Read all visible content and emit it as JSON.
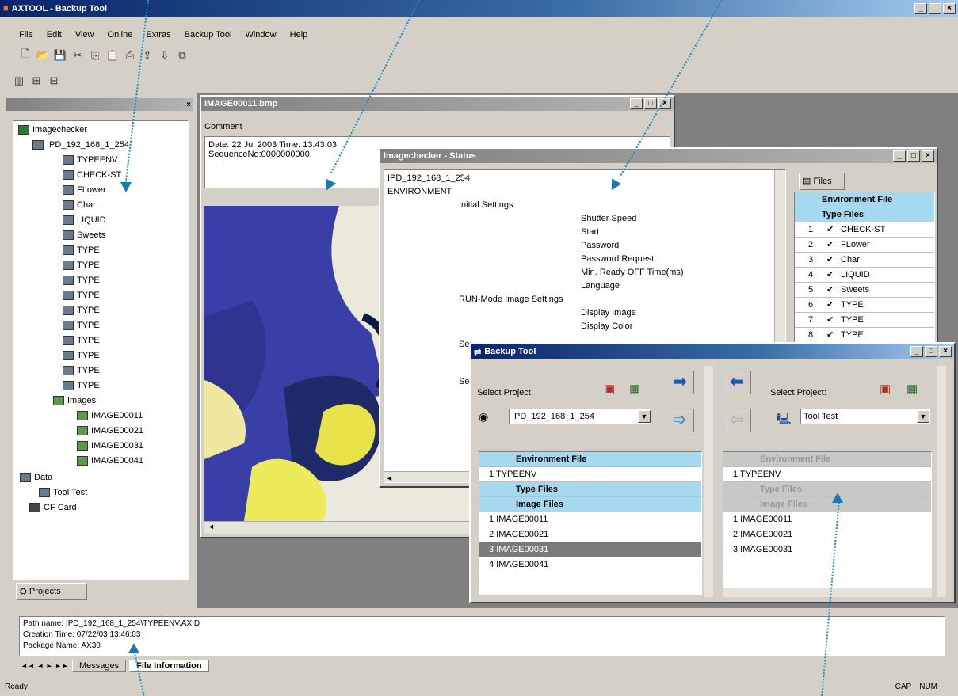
{
  "app": {
    "title": "AXTOOL - Backup Tool"
  },
  "menu": [
    "File",
    "Edit",
    "View",
    "Online",
    "Extras",
    "Backup Tool",
    "Window",
    "Help"
  ],
  "tree": {
    "root": "Imagechecker",
    "device": "IPD_192_168_1_254",
    "items": [
      "TYPEENV",
      "CHECK-ST",
      "FLower",
      "Char",
      "LIQUID",
      "Sweets",
      "TYPE",
      "TYPE",
      "TYPE",
      "TYPE",
      "TYPE",
      "TYPE",
      "TYPE",
      "TYPE",
      "TYPE",
      "TYPE"
    ],
    "images_folder": "Images",
    "images": [
      "IMAGE00011",
      "IMAGE00021",
      "IMAGE00031",
      "IMAGE00041"
    ],
    "data_folder": "Data",
    "tool_test": "Tool Test",
    "cf_card": "CF Card",
    "tab": "Projects"
  },
  "image_window": {
    "title": "IMAGE00011.bmp",
    "comment_label": "Comment",
    "date_line": "Date: 22 Jul 2003 Time: 13:43:03",
    "seq_line": "SequenceNo:0000000000"
  },
  "status_window": {
    "title": "Imagechecker - Status",
    "device": "IPD_192_168_1_254",
    "environment": "ENVIRONMENT",
    "initial_settings": "Initial Settings",
    "settings": [
      "Shutter Speed",
      "Start",
      "Password",
      "Password Request",
      "Min. Ready OFF Time(ms)",
      "Language"
    ],
    "run_mode": "RUN-Mode Image Settings",
    "run_settings": [
      "Display Image",
      "Display Color"
    ],
    "se1": "Se",
    "se2": "Se",
    "files_tab": "Files",
    "env_file": "Environment File",
    "type_files": "Type Files",
    "files": [
      {
        "n": "1",
        "name": "CHECK-ST"
      },
      {
        "n": "2",
        "name": "FLower"
      },
      {
        "n": "3",
        "name": "Char"
      },
      {
        "n": "4",
        "name": "LIQUID"
      },
      {
        "n": "5",
        "name": "Sweets"
      },
      {
        "n": "6",
        "name": "TYPE"
      },
      {
        "n": "7",
        "name": "TYPE"
      },
      {
        "n": "8",
        "name": "TYPE"
      }
    ]
  },
  "backup_window": {
    "title": "Backup Tool",
    "left": {
      "select_label": "Select Project:",
      "project": "IPD_192_168_1_254",
      "env_file": "Environment File",
      "env_item": "1 TYPEENV",
      "type_files": "Type Files",
      "image_files": "Image Files",
      "images": [
        "1 IMAGE00011",
        "2 IMAGE00021",
        "3 IMAGE00031",
        "4 IMAGE00041"
      ]
    },
    "right": {
      "select_label": "Select Project:",
      "project": "Tool Test",
      "env_file": "Environment File",
      "env_item": "1 TYPEENV",
      "type_files": "Type Files",
      "image_files": "Image Files",
      "images": [
        "1 IMAGE00011",
        "2 IMAGE00021",
        "3 IMAGE00031"
      ]
    }
  },
  "output": {
    "path": "Path name: IPD_192_168_1_254\\TYPEENV.AXID",
    "creation": "Creation Time: 07/22/03 13:46:03",
    "package": "Package Name: AX30",
    "tabs": [
      "Messages",
      "File Information"
    ]
  },
  "status": {
    "left": "Ready",
    "cap": "CAP",
    "num": "NUM"
  }
}
